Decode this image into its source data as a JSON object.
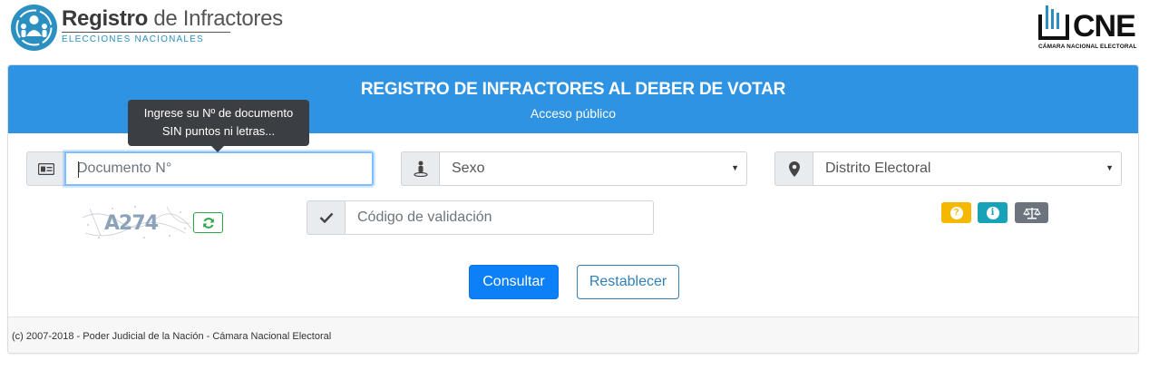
{
  "header": {
    "logo_title_bold": "Registro",
    "logo_title_light": " de Infractores",
    "logo_subtitle": "ELECCIONES NACIONALES",
    "cne_text": "CNE",
    "cne_subtitle": "CÁMARA NACIONAL ELECTORAL"
  },
  "card": {
    "title": "REGISTRO DE INFRACTORES AL DEBER DE VOTAR",
    "subtitle": "Acceso público"
  },
  "form": {
    "documento_placeholder": "Documento N°",
    "documento_tooltip_line1": "Ingrese su Nº de documento",
    "documento_tooltip_line2": "SIN puntos ni letras...",
    "sexo_selected": "Sexo",
    "distrito_selected": "Distrito Electoral",
    "codigo_placeholder": "Código de validación",
    "captcha_text": "A274"
  },
  "buttons": {
    "consultar": "Consultar",
    "restablecer": "Restablecer",
    "help_colors": [
      "#f5b800",
      "#17a2b8",
      "#6c757d"
    ]
  },
  "footer": {
    "text": "(c) 2007-2018 - Poder Judicial de la Nación - Cámara Nacional Electoral"
  },
  "colors": {
    "header_blue": "#2f93e3",
    "primary": "#0d7ff7",
    "logo_blue": "#2b8fc2"
  }
}
